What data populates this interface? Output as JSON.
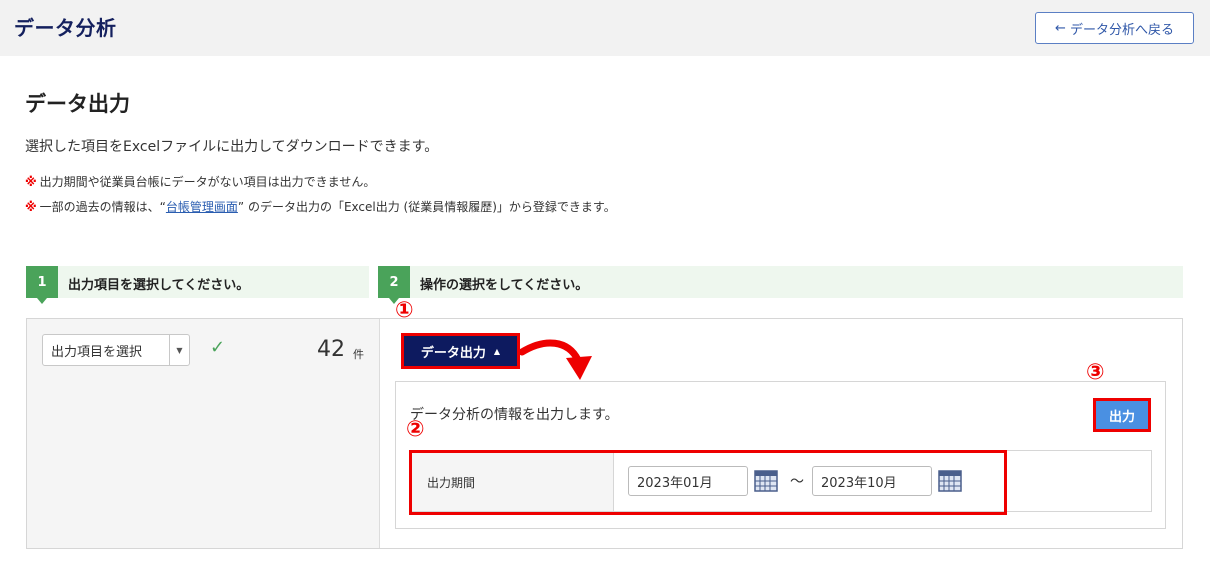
{
  "header": {
    "app_title": "データ分析",
    "back_label": "データ分析へ戻る"
  },
  "page": {
    "title": "データ出力",
    "lead": "選択した項目をExcelファイルに出力してダウンロードできます。",
    "note1_mark": "※",
    "note1_text": "出力期間や従業員台帳にデータがない項目は出力できません。",
    "note2_mark": "※",
    "note2_before": "一部の過去の情報は、“",
    "note2_link": "台帳管理画面",
    "note2_after": "” のデータ出力の「Excel出力 (従業員情報履歴)」から登録できます。"
  },
  "steps": [
    {
      "num": "1",
      "label": "出力項目を選択してください。"
    },
    {
      "num": "2",
      "label": "操作の選択をしてください。"
    }
  ],
  "left": {
    "select_label": "出力項目を選択",
    "count": "42",
    "count_unit": "件"
  },
  "right": {
    "export_label": "データ出力",
    "description": "データ分析の情報を出力します。",
    "output_label": "出力",
    "period_label": "出力期間",
    "date_from": "2023年01月",
    "date_to": "2023年10月",
    "tilde": "～"
  },
  "callouts": [
    "①",
    "②",
    "③"
  ],
  "colors": {
    "brand": "#14205e",
    "step_green": "#4aa35a",
    "annotation_red": "#ee0000",
    "output_blue": "#4a90e2"
  }
}
